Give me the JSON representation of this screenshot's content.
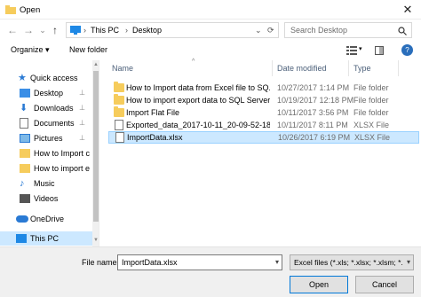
{
  "window": {
    "title": "Open",
    "close_glyph": "✕"
  },
  "nav": {
    "back_glyph": "←",
    "forward_glyph": "→",
    "dropdown_glyph": "⌄",
    "up_glyph": "↑",
    "breadcrumb": [
      "This PC",
      "Desktop"
    ],
    "breadcrumb_sep": "›",
    "search_placeholder": "Search Desktop"
  },
  "toolbar": {
    "organize_label": "Organize ▾",
    "new_folder_label": "New folder"
  },
  "sidebar": {
    "items": [
      {
        "label": "Quick access",
        "icon": "star-icon",
        "pinned": false
      },
      {
        "label": "Desktop",
        "icon": "desktop-icon",
        "pinned": true
      },
      {
        "label": "Downloads",
        "icon": "download-icon",
        "pinned": true
      },
      {
        "label": "Documents",
        "icon": "documents-icon",
        "pinned": true
      },
      {
        "label": "Pictures",
        "icon": "pictures-icon",
        "pinned": true
      },
      {
        "label": "How to Import c",
        "icon": "folder-icon",
        "pinned": false
      },
      {
        "label": "How to import e",
        "icon": "folder-icon",
        "pinned": false
      },
      {
        "label": "Music",
        "icon": "music-icon",
        "pinned": false
      },
      {
        "label": "Videos",
        "icon": "videos-icon",
        "pinned": false
      },
      {
        "label": "OneDrive",
        "icon": "cloud-icon",
        "pinned": false
      },
      {
        "label": "This PC",
        "icon": "pc-icon",
        "pinned": false
      }
    ],
    "pin_glyph": "📌"
  },
  "files": {
    "columns": {
      "name": "Name",
      "date": "Date modified",
      "type": "Type"
    },
    "rows": [
      {
        "name": "How to Import data from Excel file to SQ...",
        "date": "10/27/2017 1:14 PM",
        "type": "File folder",
        "kind": "folder"
      },
      {
        "name": "How to import export data to SQL Server ...",
        "date": "10/19/2017 12:18 PM",
        "type": "File folder",
        "kind": "folder"
      },
      {
        "name": "Import Flat File",
        "date": "10/11/2017 3:56 PM",
        "type": "File folder",
        "kind": "folder"
      },
      {
        "name": "Exported_data_2017-10-11_20-09-52-187....",
        "date": "10/11/2017 8:11 PM",
        "type": "XLSX File",
        "kind": "file"
      },
      {
        "name": "ImportData.xlsx",
        "date": "10/26/2017 6:19 PM",
        "type": "XLSX File",
        "kind": "file"
      }
    ]
  },
  "bottom": {
    "file_name_label": "File name:",
    "file_name_value": "ImportData.xlsx",
    "file_type_value": "Excel files (*.xls; *.xlsx; *.xlsm; *.>",
    "open_label": "Open",
    "cancel_label": "Cancel"
  },
  "colors": {
    "selection": "#cce8ff",
    "folder": "#f6cc5c",
    "accent": "#0078d7"
  }
}
